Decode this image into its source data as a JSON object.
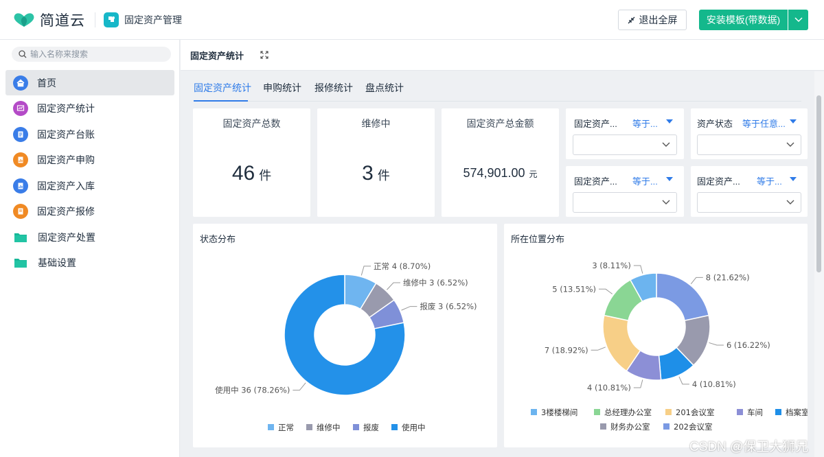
{
  "header": {
    "logo_text": "简道云",
    "app_name": "固定资产管理",
    "exit_label": "退出全屏",
    "install_label": "安装模板(带数据)"
  },
  "sidebar": {
    "search_placeholder": "输入名称来搜索",
    "items": [
      {
        "label": "首页",
        "icon": "home-icon",
        "color": "#3a7de8"
      },
      {
        "label": "固定资产统计",
        "icon": "chart-icon",
        "color": "#b44bc7"
      },
      {
        "label": "固定资产台账",
        "icon": "ledger-icon",
        "color": "#3a7de8"
      },
      {
        "label": "固定资产申购",
        "icon": "purchase-icon",
        "color": "#f08a24"
      },
      {
        "label": "固定资产入库",
        "icon": "inbound-icon",
        "color": "#3a7de8"
      },
      {
        "label": "固定资产报修",
        "icon": "repair-icon",
        "color": "#f08a24"
      },
      {
        "label": "固定资产处置",
        "icon": "folder-icon",
        "color": "#17b898"
      },
      {
        "label": "基础设置",
        "icon": "folder-icon",
        "color": "#17b898"
      }
    ]
  },
  "page": {
    "title": "固定资产统计",
    "tabs": [
      "固定资产统计",
      "申购统计",
      "报修统计",
      "盘点统计"
    ]
  },
  "kpis": [
    {
      "title": "固定资产总数",
      "value": "46",
      "unit": "件"
    },
    {
      "title": "维修中",
      "value": "3",
      "unit": "件"
    },
    {
      "title": "固定资产总金额",
      "value": "574,901.00",
      "unit": "元"
    }
  ],
  "filters": [
    {
      "label": "固定资产...",
      "op": "等于..."
    },
    {
      "label": "资产状态",
      "op": "等于任意..."
    },
    {
      "label": "固定资产...",
      "op": "等于..."
    },
    {
      "label": "固定资产...",
      "op": "等于..."
    }
  ],
  "chart_data": [
    {
      "type": "pie",
      "title": "状态分布",
      "categories": [
        "正常",
        "维修中",
        "报废",
        "使用中"
      ],
      "values": [
        4,
        3,
        3,
        36
      ],
      "labels": [
        "正常 4 (8.70%)",
        "维修中 3 (6.52%)",
        "报废 3 (6.52%)",
        "使用中 36 (78.26%)"
      ],
      "colors": [
        "#6fb5f0",
        "#999aad",
        "#7f90d8",
        "#2391e9"
      ],
      "donut": true,
      "legend": "bottom"
    },
    {
      "type": "pie",
      "title": "所在位置分布",
      "categories": [
        "202会议室",
        "档案室",
        "财务办公室",
        "车间",
        "3楼楼梯间",
        "201会议室",
        "总经理办公室"
      ],
      "values": [
        8,
        6,
        4,
        4,
        7,
        5,
        3
      ],
      "labels": [
        "8 (21.62%)",
        "6 (16.22%)",
        "4 (10.81%)",
        "4 (10.81%)",
        "7 (18.92%)",
        "5 (13.51%)",
        "3 (8.11%)"
      ],
      "colors": [
        "#7b9ae3",
        "#999aad",
        "#1e8fe8",
        "#8c8fd6",
        "#f7cf87",
        "#8ad694",
        "#6cb4ef"
      ],
      "legend_order": [
        "3楼楼梯间",
        "总经理办公室",
        "201会议室",
        "车间",
        "档案室",
        "财务办公室",
        "202会议室"
      ],
      "legend_colors": [
        "#6cb4ef",
        "#8ad694",
        "#f7cf87",
        "#8c8fd6",
        "#1e8fe8",
        "#999aad",
        "#7b9ae3"
      ],
      "donut": true,
      "legend": "bottom"
    }
  ],
  "watermark": "CSDN @保卫大狮兄"
}
